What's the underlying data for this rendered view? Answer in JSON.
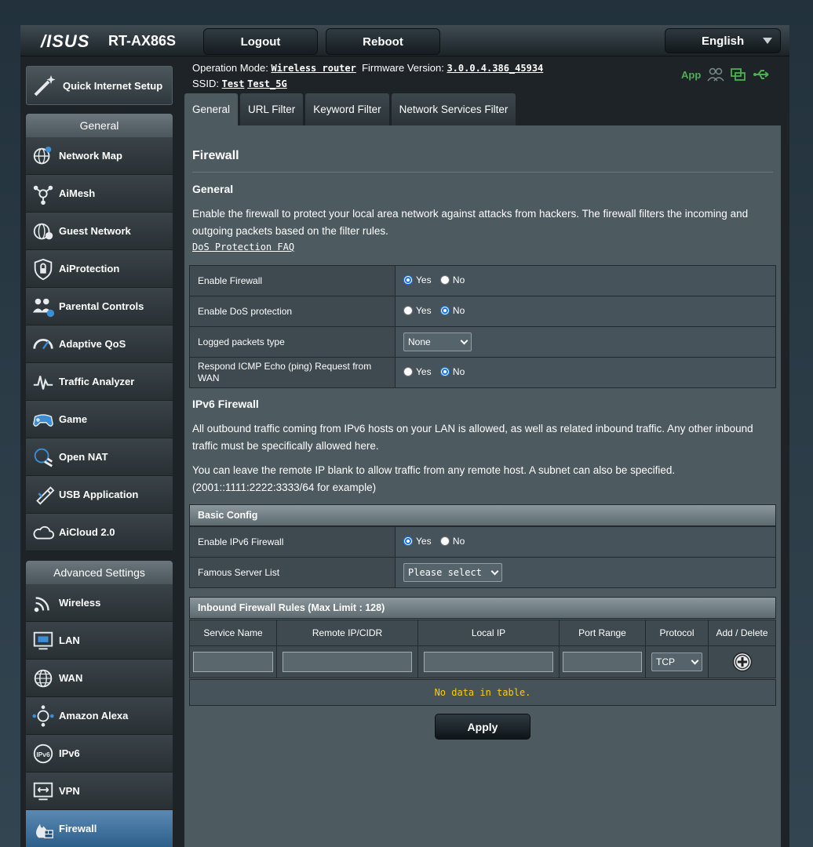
{
  "header": {
    "brand": "/ISUS",
    "model": "RT-AX86S",
    "logout_label": "Logout",
    "reboot_label": "Reboot",
    "language": "English"
  },
  "status": {
    "op_mode_label": "Operation Mode:",
    "op_mode_value": "Wireless router",
    "fw_label": "Firmware Version:",
    "fw_value": "3.0.0.4.386_45934",
    "ssid_label": "SSID:",
    "ssid_1": "Test",
    "ssid_2": "Test_5G",
    "app_label": "App"
  },
  "sidebar": {
    "qis_label": "Quick Internet Setup",
    "general_heading": "General",
    "general_items": [
      {
        "label": "Network Map",
        "icon": "globe-icon"
      },
      {
        "label": "AiMesh",
        "icon": "mesh-icon"
      },
      {
        "label": "Guest Network",
        "icon": "guest-globe-icon"
      },
      {
        "label": "AiProtection",
        "icon": "shield-lock-icon"
      },
      {
        "label": "Parental Controls",
        "icon": "family-icon"
      },
      {
        "label": "Adaptive QoS",
        "icon": "speedometer-icon"
      },
      {
        "label": "Traffic Analyzer",
        "icon": "analyzer-icon"
      },
      {
        "label": "Game",
        "icon": "gamepad-icon"
      },
      {
        "label": "Open NAT",
        "icon": "open-nat-icon"
      },
      {
        "label": "USB Application",
        "icon": "usb-icon"
      },
      {
        "label": "AiCloud 2.0",
        "icon": "cloud-icon"
      }
    ],
    "advanced_heading": "Advanced Settings",
    "advanced_items": [
      {
        "label": "Wireless",
        "icon": "wireless-icon"
      },
      {
        "label": "LAN",
        "icon": "lan-icon"
      },
      {
        "label": "WAN",
        "icon": "wan-globe-icon"
      },
      {
        "label": "Amazon Alexa",
        "icon": "alexa-icon"
      },
      {
        "label": "IPv6",
        "icon": "ipv6-icon"
      },
      {
        "label": "VPN",
        "icon": "vpn-icon"
      },
      {
        "label": "Firewall",
        "icon": "firewall-icon"
      }
    ]
  },
  "tabs": [
    "General",
    "URL Filter",
    "Keyword Filter",
    "Network Services Filter"
  ],
  "main": {
    "title": "Firewall",
    "general_heading": "General",
    "general_desc": "Enable the firewall to protect your local area network against attacks from hackers. The firewall filters the incoming and outgoing packets based on the filter rules.",
    "faq_link": "DoS Protection FAQ",
    "yes": "Yes",
    "no": "No",
    "rows": {
      "enable_firewall": "Enable Firewall",
      "enable_dos": "Enable DoS protection",
      "logged_packets": "Logged packets type",
      "logged_packets_value": "None",
      "respond_icmp": "Respond ICMP Echo (ping) Request from WAN"
    },
    "ipv6_heading": "IPv6 Firewall",
    "ipv6_desc1": "All outbound traffic coming from IPv6 hosts on your LAN is allowed, as well as related inbound traffic. Any other inbound traffic must be specifically allowed here.",
    "ipv6_desc2": "You can leave the remote IP blank to allow traffic from any remote host. A subnet can also be specified. (2001::1111:2222:3333/64 for example)",
    "basic_config": "Basic Config",
    "enable_ipv6_fw": "Enable IPv6 Firewall",
    "famous_server": "Famous Server List",
    "famous_server_value": "Please select",
    "inbound_title": "Inbound Firewall Rules (Max Limit : 128)",
    "columns": [
      "Service Name",
      "Remote IP/CIDR",
      "Local IP",
      "Port Range",
      "Protocol",
      "Add / Delete"
    ],
    "protocol_value": "TCP",
    "no_data": "No data in table.",
    "apply_label": "Apply"
  },
  "state": {
    "enable_firewall": "yes",
    "enable_dos": "no",
    "respond_icmp": "no",
    "enable_ipv6_fw": "yes"
  }
}
